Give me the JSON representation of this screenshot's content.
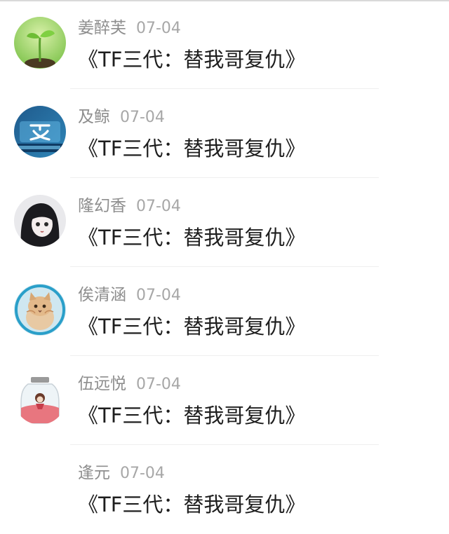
{
  "comments": [
    {
      "name": "姜醉芙",
      "date": "07-04",
      "text": "《TF三代：替我哥复仇》",
      "avatar_icon": "seedling-avatar-icon"
    },
    {
      "name": "及鲸",
      "date": "07-04",
      "text": "《TF三代：替我哥复仇》",
      "avatar_icon": "blue-character-avatar-icon"
    },
    {
      "name": "隆幻香",
      "date": "07-04",
      "text": "《TF三代：替我哥复仇》",
      "avatar_icon": "anime-girl-avatar-icon"
    },
    {
      "name": "俟清涵",
      "date": "07-04",
      "text": "《TF三代：替我哥复仇》",
      "avatar_icon": "kitten-avatar-icon"
    },
    {
      "name": "伍远悦",
      "date": "07-04",
      "text": "《TF三代：替我哥复仇》",
      "avatar_icon": "jar-avatar-icon"
    },
    {
      "name": "逢元",
      "date": "07-04",
      "text": "《TF三代：替我哥复仇》",
      "avatar_icon": ""
    }
  ]
}
